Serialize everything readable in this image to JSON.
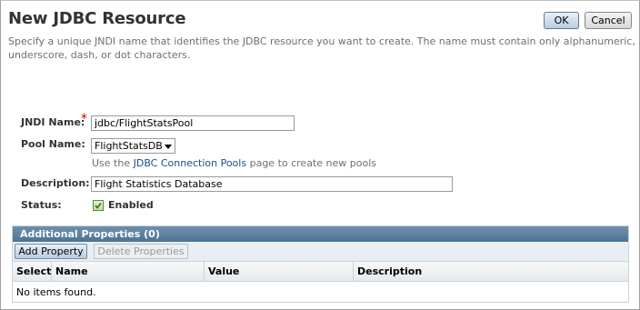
{
  "page": {
    "title": "New JDBC Resource",
    "description": "Specify a unique JNDI name that identifies the JDBC resource you want to create. The name must contain only alphanumeric, underscore, dash, or dot characters."
  },
  "toolbar": {
    "ok_label": "OK",
    "cancel_label": "Cancel"
  },
  "form": {
    "jndi_label": "JNDI Name:",
    "required_marker": "*",
    "jndi_value": "jdbc/FlightStatsPool",
    "pool_label": "Pool Name:",
    "pool_value": "FlightStatsDB",
    "pool_hint_prefix": "Use the",
    "pool_hint_link": "JDBC Connection Pools",
    "pool_hint_suffix": "page to create new pools",
    "description_label": "Description:",
    "description_value": "Flight Statistics Database",
    "status_label": "Status:",
    "status_value": "Enabled"
  },
  "properties": {
    "heading": "Additional Properties (0)",
    "add_label": "Add Property",
    "delete_label": "Delete Properties",
    "columns": [
      "Select",
      "Name",
      "Value",
      "Description"
    ],
    "empty_text": "No items found."
  }
}
